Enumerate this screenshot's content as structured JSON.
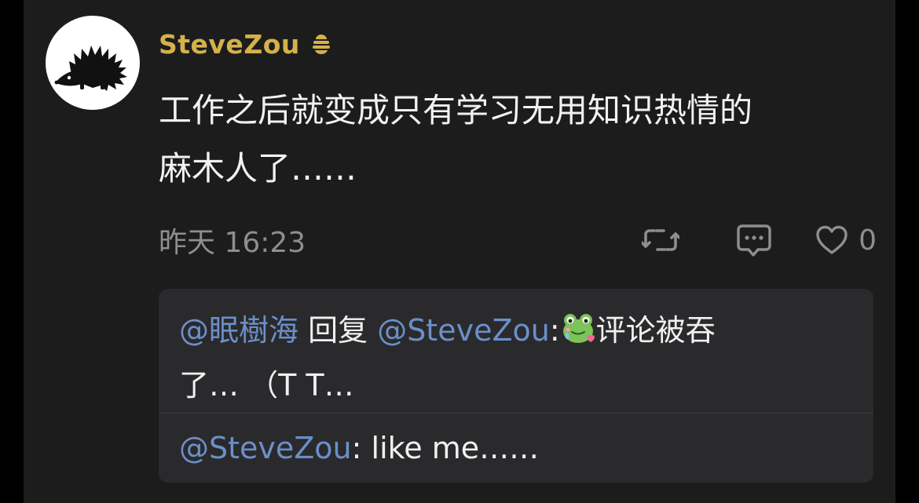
{
  "post": {
    "username": "SteveZou",
    "username_color": "#d4b14a",
    "badge_icon": "hive-badge-icon",
    "avatar_icon": "hedgehog-icon",
    "text_line1": "工作之后就变成只有学习无用知识热情的",
    "text_line2": "麻木人了……",
    "timestamp": "昨天 16:23",
    "actions": {
      "repost_icon": "repost-icon",
      "comment_icon": "comment-icon",
      "like_icon": "heart-icon",
      "like_count": "0"
    }
  },
  "replies": [
    {
      "author": "@眠樹海",
      "connector": " 回复 ",
      "target": "@SteveZou",
      "colon": ":",
      "emoji": "frog-emoji-icon",
      "text_line1": "评论被吞",
      "text_line2": "了… （T T…"
    },
    {
      "author": "@SteveZou",
      "colon": ":",
      "text": " like me……"
    }
  ],
  "colors": {
    "background": "#000000",
    "card": "#1c1c1d",
    "reply_box": "#2a2a2c",
    "mention": "#6b8fc9",
    "secondary_text": "#8e8e92"
  }
}
